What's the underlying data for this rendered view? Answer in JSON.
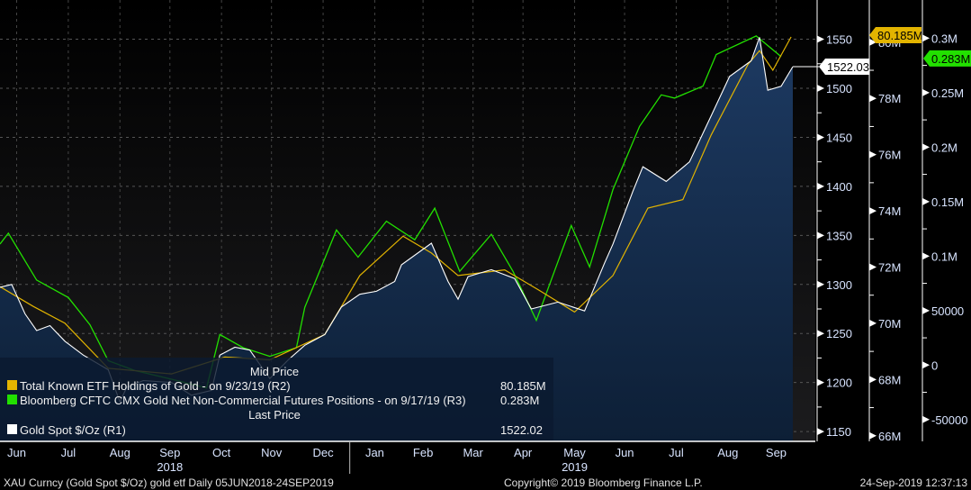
{
  "chart_data": {
    "type": "line",
    "title": "",
    "date_range": [
      "2018-06-05",
      "2019-09-24"
    ],
    "x_ticks": [
      {
        "label": "Jun",
        "date": "2018-06-15"
      },
      {
        "label": "Jul",
        "date": "2018-07-16"
      },
      {
        "label": "Aug",
        "date": "2018-08-16"
      },
      {
        "label": "Sep",
        "date": "2018-09-15"
      },
      {
        "label": "Oct",
        "date": "2018-10-16"
      },
      {
        "label": "Nov",
        "date": "2018-11-15"
      },
      {
        "label": "Dec",
        "date": "2018-12-16"
      },
      {
        "label": "Jan",
        "date": "2019-01-16"
      },
      {
        "label": "Feb",
        "date": "2019-02-14"
      },
      {
        "label": "Mar",
        "date": "2019-03-16"
      },
      {
        "label": "Apr",
        "date": "2019-04-15"
      },
      {
        "label": "May",
        "date": "2019-05-16"
      },
      {
        "label": "Jun",
        "date": "2019-06-15"
      },
      {
        "label": "Jul",
        "date": "2019-07-16"
      },
      {
        "label": "Aug",
        "date": "2019-08-16"
      },
      {
        "label": "Sep",
        "date": "2019-09-14"
      }
    ],
    "year_labels": [
      {
        "label": "2018",
        "date": "2018-09-15"
      },
      {
        "label": "2019",
        "date": "2019-05-16"
      }
    ],
    "axes": {
      "R1": {
        "ylim": [
          1140,
          1590
        ],
        "ticks": [
          1150,
          1200,
          1250,
          1300,
          1350,
          1400,
          1450,
          1500,
          1550
        ],
        "labels": [
          "1150",
          "1200",
          "1250",
          "1300",
          "1350",
          "1400",
          "1450",
          "1500",
          "1550"
        ]
      },
      "R2": {
        "ylim": [
          65.8,
          81.5
        ],
        "ticks": [
          66,
          68,
          70,
          72,
          74,
          76,
          78,
          80
        ],
        "labels": [
          "66M",
          "68M",
          "70M",
          "72M",
          "74M",
          "76M",
          "78M",
          "80M"
        ]
      },
      "R3": {
        "ylim": [
          -70000,
          335000
        ],
        "ticks": [
          -50000,
          0,
          50000,
          100000,
          150000,
          200000,
          250000,
          300000
        ],
        "labels": [
          "-50000",
          "0",
          "50000",
          "0.1M",
          "0.15M",
          "0.2M",
          "0.25M",
          "0.3M"
        ]
      }
    },
    "series": [
      {
        "name": "Gold Spot $/Oz (R1)",
        "axis": "R1",
        "color": "#ffffff",
        "fill": "#0f2745",
        "last_value": "1522.02",
        "last_tag": "1522.03",
        "points": [
          [
            "2018-06-05",
            1297
          ],
          [
            "2018-06-12",
            1300
          ],
          [
            "2018-06-20",
            1270
          ],
          [
            "2018-06-27",
            1253
          ],
          [
            "2018-07-05",
            1258
          ],
          [
            "2018-07-14",
            1242
          ],
          [
            "2018-07-25",
            1228
          ],
          [
            "2018-08-09",
            1213
          ],
          [
            "2018-08-16",
            1180
          ],
          [
            "2018-08-20",
            1195
          ],
          [
            "2018-08-30",
            1202
          ],
          [
            "2018-09-16",
            1200
          ],
          [
            "2018-09-28",
            1187
          ],
          [
            "2018-10-10",
            1192
          ],
          [
            "2018-10-15",
            1228
          ],
          [
            "2018-10-24",
            1236
          ],
          [
            "2018-11-02",
            1233
          ],
          [
            "2018-11-14",
            1204
          ],
          [
            "2018-11-25",
            1223
          ],
          [
            "2018-12-05",
            1238
          ],
          [
            "2018-12-17",
            1249
          ],
          [
            "2018-12-27",
            1277
          ],
          [
            "2019-01-07",
            1290
          ],
          [
            "2019-01-17",
            1293
          ],
          [
            "2019-01-28",
            1303
          ],
          [
            "2019-02-01",
            1320
          ],
          [
            "2019-02-19",
            1342
          ],
          [
            "2019-03-01",
            1303
          ],
          [
            "2019-03-07",
            1285
          ],
          [
            "2019-03-13",
            1308
          ],
          [
            "2019-03-27",
            1315
          ],
          [
            "2019-04-10",
            1306
          ],
          [
            "2019-04-20",
            1275
          ],
          [
            "2019-05-06",
            1282
          ],
          [
            "2019-05-22",
            1273
          ],
          [
            "2019-06-03",
            1322
          ],
          [
            "2019-06-08",
            1341
          ],
          [
            "2019-06-20",
            1395
          ],
          [
            "2019-06-26",
            1420
          ],
          [
            "2019-07-10",
            1405
          ],
          [
            "2019-07-24",
            1425
          ],
          [
            "2019-08-06",
            1472
          ],
          [
            "2019-08-17",
            1512
          ],
          [
            "2019-08-30",
            1528
          ],
          [
            "2019-09-04",
            1552
          ],
          [
            "2019-09-09",
            1498
          ],
          [
            "2019-09-17",
            1502
          ],
          [
            "2019-09-24",
            1522.02
          ]
        ]
      },
      {
        "name": "Total Known ETF Holdings of Gold -  on 9/23/19  (R2)",
        "axis": "R2",
        "color": "#e2b400",
        "legend_header": "Mid Price",
        "last_value": "80.185M",
        "last_tag": "80.185M",
        "points": [
          [
            "2018-06-05",
            71.3
          ],
          [
            "2018-06-25",
            70.6
          ],
          [
            "2018-07-14",
            70.0
          ],
          [
            "2018-08-09",
            68.4
          ],
          [
            "2018-09-16",
            68.2
          ],
          [
            "2018-10-18",
            68.8
          ],
          [
            "2018-11-14",
            68.7
          ],
          [
            "2018-12-17",
            69.6
          ],
          [
            "2019-01-07",
            71.7
          ],
          [
            "2019-02-02",
            73.1
          ],
          [
            "2019-02-19",
            72.5
          ],
          [
            "2019-03-07",
            71.7
          ],
          [
            "2019-04-04",
            71.9
          ],
          [
            "2019-04-24",
            71.2
          ],
          [
            "2019-05-16",
            70.4
          ],
          [
            "2019-06-08",
            71.7
          ],
          [
            "2019-06-29",
            74.1
          ],
          [
            "2019-07-20",
            74.4
          ],
          [
            "2019-08-06",
            76.7
          ],
          [
            "2019-08-28",
            79.2
          ],
          [
            "2019-09-04",
            79.7
          ],
          [
            "2019-09-12",
            79.0
          ],
          [
            "2019-09-23",
            80.185
          ]
        ]
      },
      {
        "name": "Bloomberg CFTC CMX Gold Net Non-Commercial Futures Positions -  on 9/17/19  (R3)",
        "axis": "R3",
        "color": "#22e000",
        "last_value": "0.283M",
        "last_tag": "0.283M",
        "points": [
          [
            "2018-06-05",
            111000
          ],
          [
            "2018-06-10",
            121000
          ],
          [
            "2018-06-27",
            78000
          ],
          [
            "2018-07-16",
            62000
          ],
          [
            "2018-07-29",
            37000
          ],
          [
            "2018-08-09",
            4000
          ],
          [
            "2018-08-25",
            -5000
          ],
          [
            "2018-09-16",
            -13000
          ],
          [
            "2018-10-07",
            -21000
          ],
          [
            "2018-10-15",
            28000
          ],
          [
            "2018-10-29",
            16000
          ],
          [
            "2018-11-14",
            8000
          ],
          [
            "2018-11-30",
            16000
          ],
          [
            "2018-12-05",
            53000
          ],
          [
            "2018-12-24",
            124000
          ],
          [
            "2019-01-06",
            99000
          ],
          [
            "2019-01-23",
            132000
          ],
          [
            "2019-02-09",
            115000
          ],
          [
            "2019-02-21",
            144000
          ],
          [
            "2019-03-08",
            86000
          ],
          [
            "2019-03-27",
            120000
          ],
          [
            "2019-04-09",
            86000
          ],
          [
            "2019-04-23",
            41000
          ],
          [
            "2019-05-14",
            128000
          ],
          [
            "2019-05-25",
            90000
          ],
          [
            "2019-06-08",
            161000
          ],
          [
            "2019-06-24",
            219000
          ],
          [
            "2019-07-07",
            248000
          ],
          [
            "2019-07-15",
            245000
          ],
          [
            "2019-08-01",
            256000
          ],
          [
            "2019-08-09",
            285000
          ],
          [
            "2019-09-02",
            302000
          ],
          [
            "2019-09-17",
            283000
          ]
        ]
      }
    ],
    "legend": {
      "placement": "bottom-left",
      "mid_price_header": "Mid Price",
      "last_price_header": "Last Price"
    },
    "grid": true
  },
  "footer": {
    "security": "XAU Curncy (Gold Spot   $/Oz) gold etf  Daily 05JUN2018-24SEP2019",
    "copyright": "Copyright© 2019 Bloomberg Finance L.P.",
    "timestamp": "24-Sep-2019 12:37:13"
  }
}
